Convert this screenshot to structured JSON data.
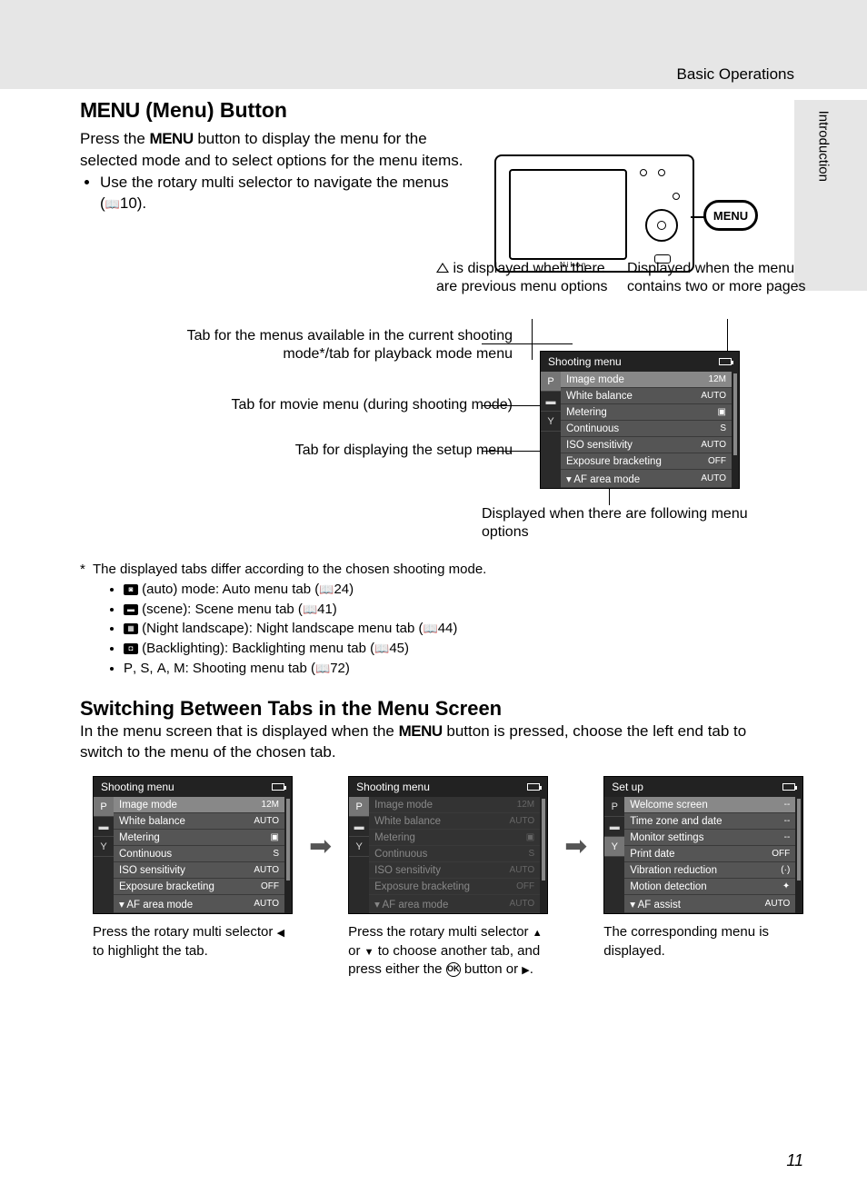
{
  "header": {
    "breadcrumb": "Basic Operations",
    "side_tab": "Introduction",
    "page_number": "11"
  },
  "section1": {
    "menu_word": "MENU",
    "title_rest": " (Menu) Button",
    "para": "Press the ",
    "para2": " button to display the menu for the selected mode and to select options for the menu items.",
    "bullet1a": "Use the rotary multi selector to navigate the menus (",
    "bullet1b": "10)."
  },
  "camera": {
    "menu_label": "MENU"
  },
  "diagram": {
    "ann_top1a": "is displayed when there are previous menu options",
    "ann_top2": "Displayed when the menu contains two or more pages",
    "ann_left1": "Tab for the menus available in the current shooting mode*/tab for playback mode menu",
    "ann_left2": "Tab for movie menu (during shooting mode)",
    "ann_left3": "Tab for displaying the setup menu",
    "ann_bottom": "Displayed when there are following menu options"
  },
  "menu_diag": {
    "title": "Shooting menu",
    "tabs": [
      "P",
      "",
      ""
    ],
    "items": [
      {
        "label": "Image mode",
        "val": "12M",
        "hl": true
      },
      {
        "label": "White balance",
        "val": "AUTO"
      },
      {
        "label": "Metering",
        "val": "▣"
      },
      {
        "label": "Continuous",
        "val": "S"
      },
      {
        "label": "ISO sensitivity",
        "val": "AUTO"
      },
      {
        "label": "Exposure bracketing",
        "val": "OFF"
      },
      {
        "label": "AF area mode",
        "val": "AUTO",
        "arrow": true
      }
    ]
  },
  "footnote": {
    "intro": "The displayed tabs differ according to the chosen shooting mode.",
    "items": [
      {
        "label": " (auto) mode: Auto menu tab (",
        "ref": "24)"
      },
      {
        "label": " (scene): Scene menu tab (",
        "ref": "41)"
      },
      {
        "label": " (Night landscape): Night landscape menu tab (",
        "ref": "44)"
      },
      {
        "label": " (Backlighting): Backlighting menu tab (",
        "ref": "45)"
      }
    ],
    "psam_a": "P",
    "psam_b": "S",
    "psam_c": "A",
    "psam_d": "M",
    "psam_rest": ": Shooting menu tab (",
    "psam_ref": "72)"
  },
  "section2": {
    "title": "Switching Between Tabs in the Menu Screen",
    "para_a": "In the menu screen that is displayed when the ",
    "para_b": " button is pressed, choose the left end tab to switch to the menu of the chosen tab."
  },
  "menus": {
    "m1": {
      "title": "Shooting menu",
      "tabs_sel": 0,
      "items": [
        {
          "label": "Image mode",
          "val": "12M",
          "hl": true
        },
        {
          "label": "White balance",
          "val": "AUTO"
        },
        {
          "label": "Metering",
          "val": "▣"
        },
        {
          "label": "Continuous",
          "val": "S"
        },
        {
          "label": "ISO sensitivity",
          "val": "AUTO"
        },
        {
          "label": "Exposure bracketing",
          "val": "OFF"
        },
        {
          "label": "AF area mode",
          "val": "AUTO",
          "arrow": true
        }
      ],
      "caption_a": "Press the rotary multi selector ",
      "caption_b": " to highlight the tab."
    },
    "m2": {
      "title": "Shooting menu",
      "tabs_sel": 0,
      "dim": true,
      "items": [
        {
          "label": "Image mode",
          "val": "12M"
        },
        {
          "label": "White balance",
          "val": "AUTO"
        },
        {
          "label": "Metering",
          "val": "▣"
        },
        {
          "label": "Continuous",
          "val": "S"
        },
        {
          "label": "ISO sensitivity",
          "val": "AUTO"
        },
        {
          "label": "Exposure bracketing",
          "val": "OFF"
        },
        {
          "label": "AF area mode",
          "val": "AUTO",
          "arrow": true
        }
      ],
      "caption_a": "Press the rotary multi selector ",
      "caption_b": " or ",
      "caption_c": " to choose another tab, and press either the ",
      "caption_d": " button or ",
      "caption_e": "."
    },
    "m3": {
      "title": "Set up",
      "tabs_sel": 2,
      "items": [
        {
          "label": "Welcome screen",
          "val": "--",
          "hl": true
        },
        {
          "label": "Time zone and date",
          "val": "--"
        },
        {
          "label": "Monitor settings",
          "val": "--"
        },
        {
          "label": "Print date",
          "val": "OFF"
        },
        {
          "label": "Vibration reduction",
          "val": "(·)"
        },
        {
          "label": "Motion detection",
          "val": "✦"
        },
        {
          "label": "AF assist",
          "val": "AUTO",
          "arrow": true
        }
      ],
      "caption": "The corresponding menu is displayed."
    },
    "tab_glyphs": [
      "P",
      "▬",
      "Y"
    ]
  }
}
